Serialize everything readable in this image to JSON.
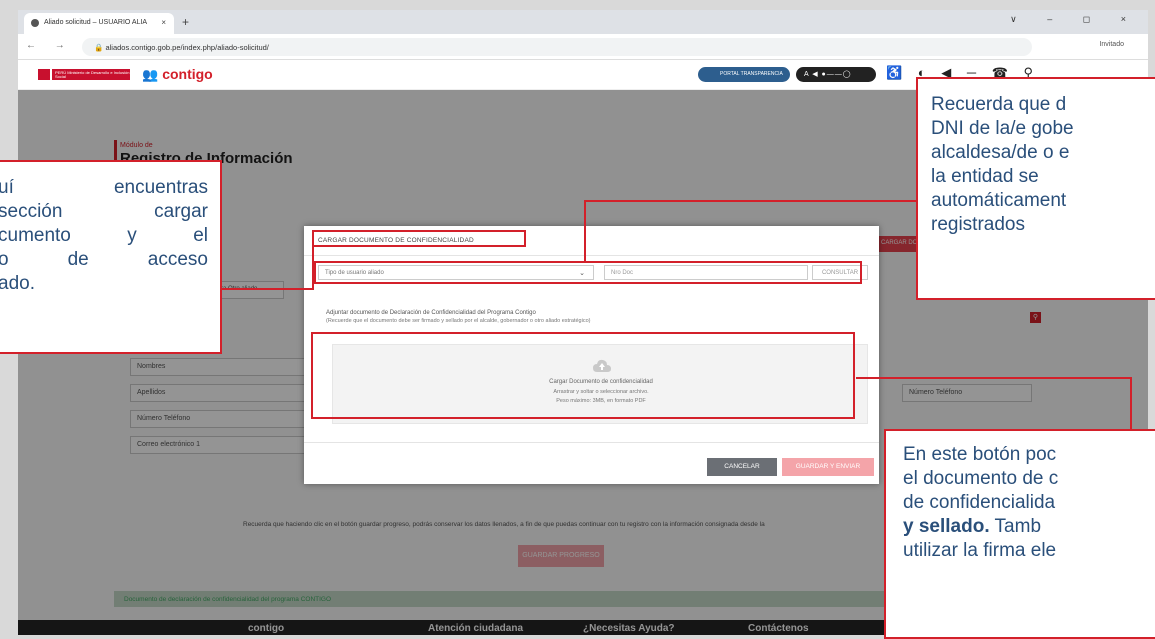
{
  "browser": {
    "tab_title": "Aliado solicitud – USUARIO ALIA",
    "tab_close": "×",
    "new_tab": "+",
    "window_controls": "∨ – ◻ ×",
    "nav_icons": "← → C",
    "url": "aliados.contigo.gob.pe/index.php/aliado-solicitud/",
    "profile": "Invitado"
  },
  "site_header": {
    "gob_text": "PERÚ  Ministerio de Desarrollo e Inclusión Social",
    "brand": "contigo",
    "portal": "PORTAL TRANSPARENCIA",
    "a11y": "A ◀ ●——◯",
    "icons": "♿ ◐ ◀ ─ ☎ ⚲"
  },
  "page": {
    "modulo_label": "Módulo de",
    "title": "Registro de Información",
    "side_button": "CARGAR DOC",
    "fields": [
      "Nombres",
      "Apellidos",
      "Número Teléfono",
      "Correo electrónico 1"
    ],
    "right_field": "Número Teléfono",
    "tab_partial": "adora    Otro aliado",
    "disclaimer": "Recuerda que haciendo clic en el botón guardar progreso, podrás conservar los datos llenados, a fin de que puedas continuar con tu registro con la información consignada desde la",
    "save_progress": "GUARDAR PROGRESO",
    "doc_bar": "Documento de declaración de confidencialidad del programa CONTIGO",
    "footer": [
      "contigo",
      "Atención ciudadana",
      "¿Necesitas Ayuda?",
      "Contáctenos"
    ]
  },
  "modal": {
    "title": "CARGAR DOCUMENTO DE CONFIDENCIALIDAD",
    "user_type_placeholder": "Tipo de usuario aliado",
    "doc_number_placeholder": "Nro Doc",
    "consult_button": "CONSULTAR",
    "attach_text": "Adjuntar documento de Declaración de Confidencialidad del Programa Contigo",
    "attach_note": "(Recuerde que el documento debe ser firmado y sellado por el alcalde, gobernador o otro aliado estratégico)",
    "dropzone_title": "Cargar Documento de confidencialidad",
    "dropzone_drag": "Arrastrar y soltar o seleccionar archivo.",
    "dropzone_limit": "Peso máximo: 3MB, en formato PDF",
    "cancel_button": "CANCELAR",
    "save_button": "GUARDAR Y ENVIAR"
  },
  "callouts": {
    "left": [
      "uí encuentras",
      "sección cargar",
      "cumento y el",
      "o de acceso",
      "ado."
    ],
    "top_right": [
      "Recuerda que d",
      "DNI de la/e gobe",
      "alcaldesa/de o e",
      "la entidad se",
      "automáticament",
      "registrados"
    ],
    "bottom_right_1": "En este botón poc",
    "bottom_right_2": "el documento de c",
    "bottom_right_3": "de confidencialida",
    "bottom_right_4_bold": "y sellado.",
    "bottom_right_4_rest": " Tamb",
    "bottom_right_5": "utilizar la firma ele"
  },
  "colors": {
    "accent": "#d3202a",
    "callout_text": "#2a4f7a"
  }
}
